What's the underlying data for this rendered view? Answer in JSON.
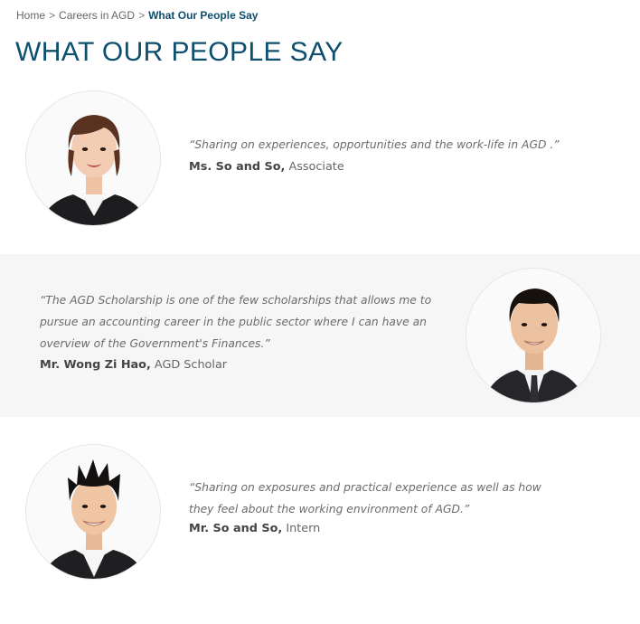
{
  "breadcrumb": {
    "items": [
      "Home",
      "Careers in AGD"
    ],
    "separator": ">",
    "current": "What Our People Say"
  },
  "page": {
    "title": "WHAT OUR PEOPLE SAY"
  },
  "colors": {
    "accent": "#0d4f6e",
    "band_background": "#f6f6f6",
    "text": "#6b6b6b"
  },
  "testimonials": [
    {
      "quote": "“Sharing on experiences, opportunities and the work-life in AGD .”",
      "name": "Ms. So and So,",
      "role": "Associate",
      "photo": "female-associate-portrait"
    },
    {
      "quote": "“The AGD Scholarship is one of the few scholarships that allows me to pursue an accounting career in the public sector where I can have an overview of the Government's Finances.”",
      "name": "Mr. Wong Zi Hao,",
      "role": "AGD Scholar",
      "photo": "male-scholar-portrait"
    },
    {
      "quote": "“Sharing on exposures and practical experience as well as how they feel about the working environment of AGD.”",
      "name": "Mr. So and So,",
      "role": "Intern",
      "photo": "male-intern-portrait"
    }
  ]
}
